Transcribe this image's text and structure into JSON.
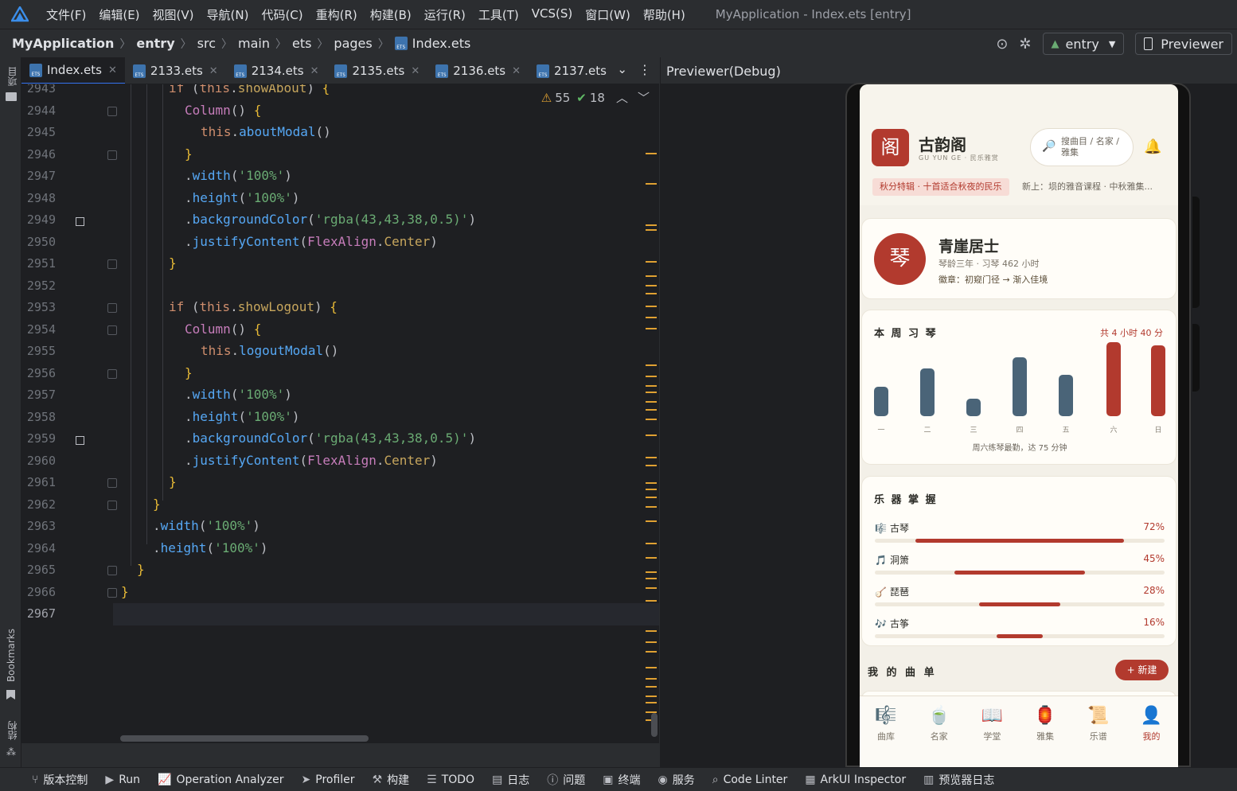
{
  "menubar": {
    "items": [
      "文件(F)",
      "编辑(E)",
      "视图(V)",
      "导航(N)",
      "代码(C)",
      "重构(R)",
      "构建(B)",
      "运行(R)",
      "工具(T)",
      "VCS(S)",
      "窗口(W)",
      "帮助(H)"
    ],
    "window_title": "MyApplication - Index.ets [entry]"
  },
  "breadcrumb": {
    "items": [
      "MyApplication",
      "entry",
      "src",
      "main",
      "ets",
      "pages",
      "Index.ets"
    ]
  },
  "toolbar": {
    "module": "entry",
    "previewer": "Previewer"
  },
  "left_strip": {
    "project": "项目",
    "bookmarks": "Bookmarks",
    "structure": "结构"
  },
  "tabs": [
    {
      "label": "Index.ets",
      "active": true
    },
    {
      "label": "2133.ets",
      "active": false
    },
    {
      "label": "2134.ets",
      "active": false
    },
    {
      "label": "2135.ets",
      "active": false
    },
    {
      "label": "2136.ets",
      "active": false
    },
    {
      "label": "2137.ets",
      "active": false
    }
  ],
  "inspections": {
    "warnings": "55",
    "weak_warnings": "18"
  },
  "code": {
    "lines": [
      {
        "n": "2943",
        "text": "if (this.showAbout) {"
      },
      {
        "n": "2944",
        "text": "Column() {"
      },
      {
        "n": "2945",
        "text": "this.aboutModal()"
      },
      {
        "n": "2946",
        "text": "}"
      },
      {
        "n": "2947",
        "text": ".width('100%')"
      },
      {
        "n": "2948",
        "text": ".height('100%')"
      },
      {
        "n": "2949",
        "text": ".backgroundColor('rgba(43,43,38,0.5)')"
      },
      {
        "n": "2950",
        "text": ".justifyContent(FlexAlign.Center)"
      },
      {
        "n": "2951",
        "text": "}"
      },
      {
        "n": "2952",
        "text": ""
      },
      {
        "n": "2953",
        "text": "if (this.showLogout) {"
      },
      {
        "n": "2954",
        "text": "Column() {"
      },
      {
        "n": "2955",
        "text": "this.logoutModal()"
      },
      {
        "n": "2956",
        "text": "}"
      },
      {
        "n": "2957",
        "text": ".width('100%')"
      },
      {
        "n": "2958",
        "text": ".height('100%')"
      },
      {
        "n": "2959",
        "text": ".backgroundColor('rgba(43,43,38,0.5)')"
      },
      {
        "n": "2960",
        "text": ".justifyContent(FlexAlign.Center)"
      },
      {
        "n": "2961",
        "text": "}"
      },
      {
        "n": "2962",
        "text": "}"
      },
      {
        "n": "2963",
        "text": ".width('100%')"
      },
      {
        "n": "2964",
        "text": ".height('100%')"
      },
      {
        "n": "2965",
        "text": "}"
      },
      {
        "n": "2966",
        "text": "}"
      },
      {
        "n": "2967",
        "text": ""
      }
    ]
  },
  "previewer": {
    "title": "Previewer(Debug)",
    "app": {
      "logo_char": "阁",
      "name": "古韵阁",
      "subtitle": "GU YUN GE · 民乐雅赏",
      "search_placeholder": "搜曲目 / 名家 / 雅集",
      "banner_tag": "秋分特辑 · 十首适合秋夜的民乐",
      "banner_news": "新上：埙的雅音课程 · 中秋雅集...",
      "profile": {
        "avatar_char": "琴",
        "name": "青崖居士",
        "meta": "琴龄三年 · 习琴 462 小时",
        "badge": "徽章：初窥门径 → 渐入佳境"
      },
      "weekly": {
        "title": "本 周 习 琴",
        "total": "共 4 小时 40 分",
        "note": "周六练琴最勤，达 75 分钟"
      },
      "skills_title": "乐 器 掌 握",
      "skills": [
        {
          "icon": "🎼",
          "name": "古琴",
          "pct_label": "72%",
          "value": 0.72
        },
        {
          "icon": "🎵",
          "name": "洞箫",
          "pct_label": "45%",
          "value": 0.45
        },
        {
          "icon": "🪕",
          "name": "琵琶",
          "pct_label": "28%",
          "value": 0.28
        },
        {
          "icon": "🎶",
          "name": "古筝",
          "pct_label": "16%",
          "value": 0.16
        }
      ],
      "playlist_title": "我 的 曲 单",
      "new_button": "+ 新建",
      "bottom_nav": [
        {
          "icon": "🎼",
          "label": "曲库",
          "active": false
        },
        {
          "icon": "🍵",
          "label": "名家",
          "active": false
        },
        {
          "icon": "📖",
          "label": "学堂",
          "active": false
        },
        {
          "icon": "🏮",
          "label": "雅集",
          "active": false
        },
        {
          "icon": "📜",
          "label": "乐谱",
          "active": false
        },
        {
          "icon": "👤",
          "label": "我的",
          "active": true
        }
      ],
      "colors": {
        "accent_red": "#b23a2e",
        "slate": "#4a6478",
        "paper": "#f3f0e8"
      }
    }
  },
  "chart_data": {
    "type": "bar",
    "categories": [
      "一",
      "二",
      "三",
      "四",
      "五",
      "六",
      "日"
    ],
    "values": [
      30,
      48,
      18,
      60,
      42,
      75,
      72
    ],
    "highlight": [
      "六",
      "日"
    ],
    "title": "本 周 习 琴",
    "xlabel": "",
    "ylabel": "",
    "ylim": [
      0,
      75
    ],
    "grid": false,
    "colors": {
      "normal": "#4a6478",
      "weekend": "#b23a2e"
    }
  },
  "statusbar": {
    "items": [
      {
        "icon": "branch-icon",
        "label": "版本控制"
      },
      {
        "icon": "run-icon",
        "label": "Run"
      },
      {
        "icon": "analyzer-icon",
        "label": "Operation Analyzer"
      },
      {
        "icon": "profiler-icon",
        "label": "Profiler"
      },
      {
        "icon": "hammer-icon",
        "label": "构建"
      },
      {
        "icon": "list-icon",
        "label": "TODO"
      },
      {
        "icon": "log-icon",
        "label": "日志"
      },
      {
        "icon": "info-icon",
        "label": "问题"
      },
      {
        "icon": "terminal-icon",
        "label": "终端"
      },
      {
        "icon": "services-icon",
        "label": "服务"
      },
      {
        "icon": "linter-icon",
        "label": "Code Linter"
      },
      {
        "icon": "inspector-icon",
        "label": "ArkUI Inspector"
      },
      {
        "icon": "previewer-log-icon",
        "label": "预览器日志"
      }
    ]
  }
}
